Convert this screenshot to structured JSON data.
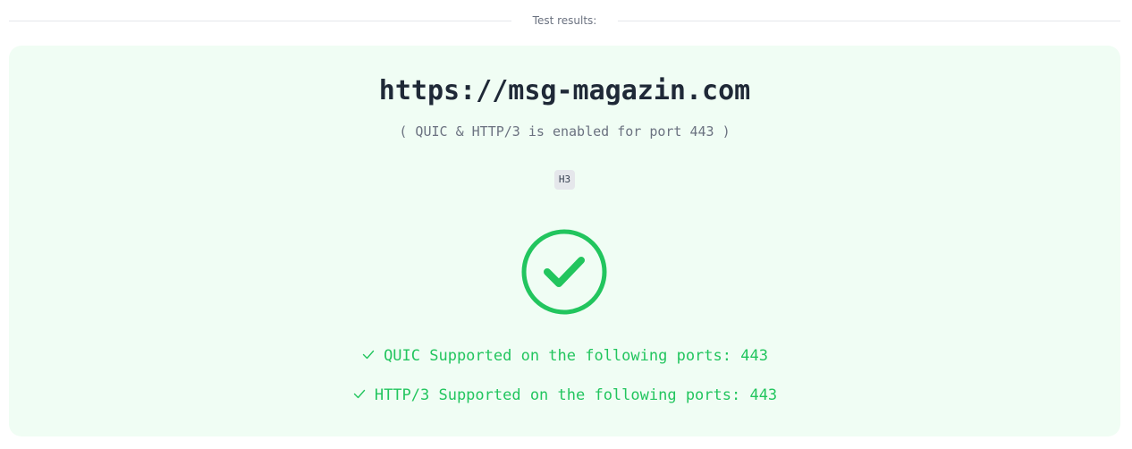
{
  "header": {
    "section_label": "Test results:"
  },
  "result": {
    "host": "https://msg-magazin.com",
    "status_note": "( QUIC & HTTP/3 is enabled for port 443 )",
    "badge": "H3",
    "status_icon": "check-circle-icon",
    "accent_color": "#22c55e",
    "background_color": "#f0fdf4",
    "support_lines": [
      {
        "icon": "check-icon",
        "text": "QUIC Supported on the following ports: 443"
      },
      {
        "icon": "check-icon",
        "text": "HTTP/3 Supported on the following ports: 443"
      }
    ]
  }
}
